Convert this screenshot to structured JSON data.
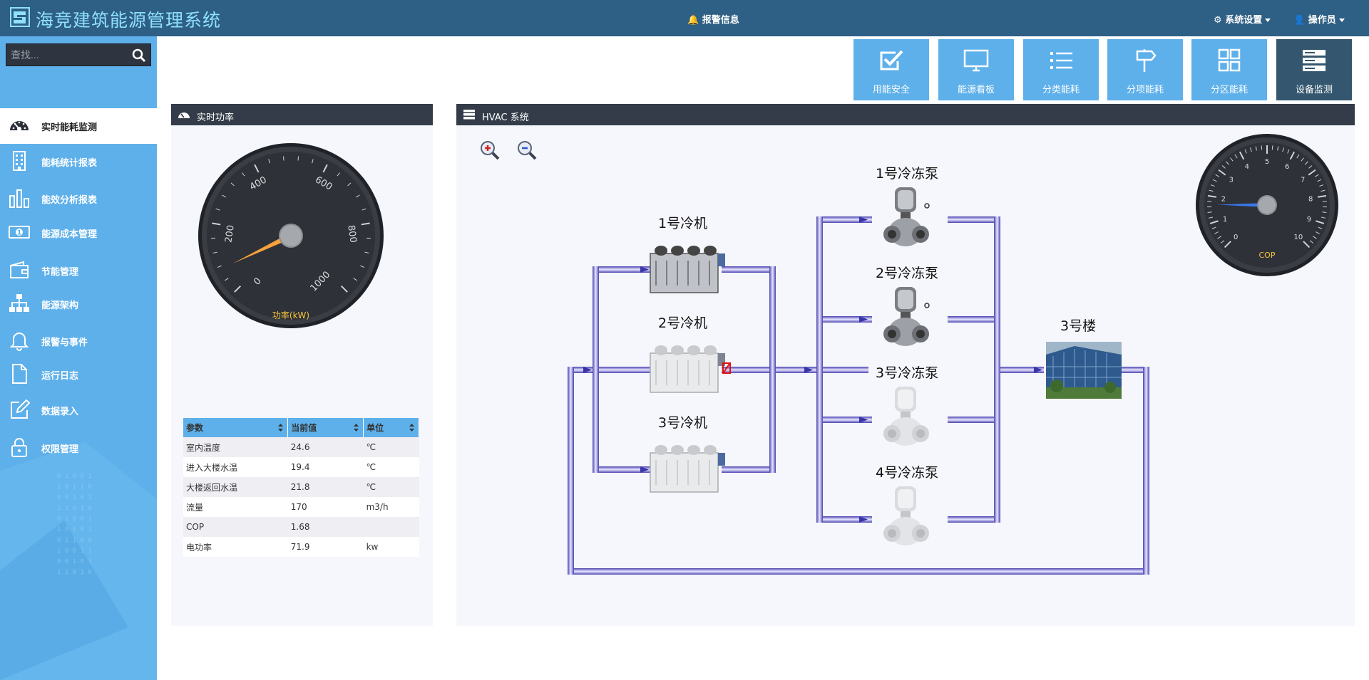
{
  "header": {
    "title": "海竞建筑能源管理系统",
    "alarm": "报警信息",
    "settings": "系统设置",
    "operator": "操作员"
  },
  "sidebar": {
    "search_placeholder": "查找...",
    "items": [
      {
        "label": "实时能耗监测",
        "icon": "speedometer-icon",
        "active": true
      },
      {
        "label": "能耗统计报表",
        "icon": "building-icon"
      },
      {
        "label": "能效分析报表",
        "icon": "bar-chart-icon"
      },
      {
        "label": "能源成本管理",
        "icon": "money-icon"
      },
      {
        "label": "节能管理",
        "icon": "wallet-icon"
      },
      {
        "label": "能源架构",
        "icon": "sitemap-icon"
      },
      {
        "label": "报警与事件",
        "icon": "bell-icon"
      },
      {
        "label": "运行日志",
        "icon": "document-icon"
      },
      {
        "label": "数据录入",
        "icon": "edit-icon"
      },
      {
        "label": "权限管理",
        "icon": "lock-icon"
      }
    ]
  },
  "tiles": [
    {
      "label": "用能安全",
      "icon": "checkbox-icon"
    },
    {
      "label": "能源看板",
      "icon": "monitor-icon"
    },
    {
      "label": "分类能耗",
      "icon": "list-icon"
    },
    {
      "label": "分项能耗",
      "icon": "signpost-icon"
    },
    {
      "label": "分区能耗",
      "icon": "grid-icon"
    },
    {
      "label": "设备监测",
      "icon": "server-icon",
      "active": true
    }
  ],
  "power_panel": {
    "title": "实时功率",
    "gauge": {
      "label": "功率(kW)",
      "ticks": [
        "0",
        "200",
        "400",
        "600",
        "800",
        "1000"
      ],
      "min": 0,
      "max": 1000,
      "value": 72
    },
    "table": {
      "headers": [
        "参数",
        "当前值",
        "单位"
      ],
      "rows": [
        [
          "室内温度",
          "24.6",
          "℃"
        ],
        [
          "进入大楼水温",
          "19.4",
          "℃"
        ],
        [
          "大楼返回水温",
          "21.8",
          "℃"
        ],
        [
          "流量",
          "170",
          "m3/h"
        ],
        [
          "COP",
          "1.68",
          ""
        ],
        [
          "电功率",
          "71.9",
          "kw"
        ]
      ]
    }
  },
  "hvac_panel": {
    "title": "HVAC 系统",
    "chillers": [
      "1号冷机",
      "2号冷机",
      "3号冷机"
    ],
    "pumps": [
      "1号冷冻泵",
      "2号冷冻泵",
      "3号冷冻泵",
      "4号冷冻泵"
    ],
    "building": "3号楼",
    "cop_gauge": {
      "label": "COP",
      "ticks": [
        "0",
        "1",
        "2",
        "3",
        "4",
        "5",
        "6",
        "7",
        "8",
        "9",
        "10"
      ],
      "min": 0,
      "max": 10,
      "value": 1.68
    }
  },
  "colors": {
    "header_bg": "#2e5f84",
    "sidebar_bg": "#5eb0ea",
    "pipe": "#5a55c0",
    "gauge_needle_power": "#f7a23b",
    "gauge_needle_cop": "#3a78e8"
  }
}
